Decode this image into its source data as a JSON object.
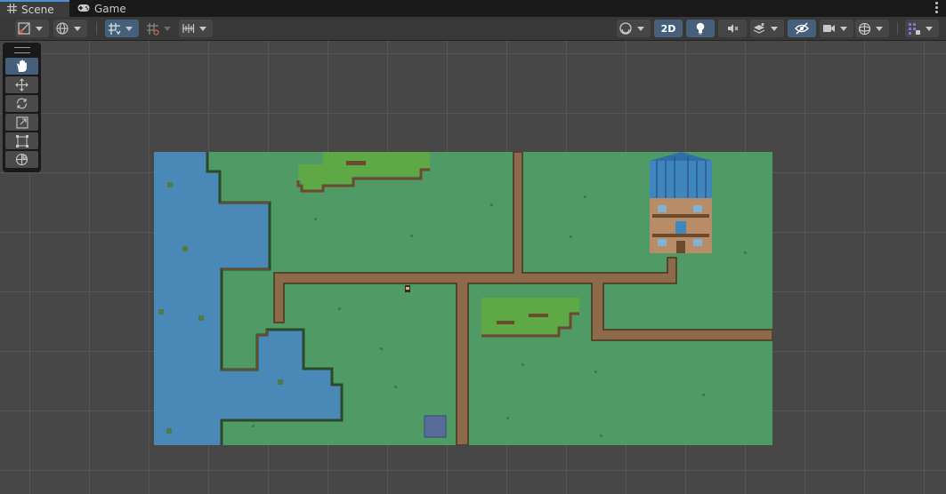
{
  "tabs": [
    {
      "label": "Scene",
      "icon": "grid-icon",
      "active": true
    },
    {
      "label": "Game",
      "icon": "gamepad-icon",
      "active": false
    }
  ],
  "toolbar": {
    "mode_2d_label": "2D"
  },
  "scene_tools": [
    "hand-tool",
    "move-tool",
    "rotate-tool",
    "scale-tool",
    "rect-tool",
    "transform-tool"
  ],
  "colors": {
    "water": "#4a88b8",
    "grass": "#4f9a65",
    "light_grass": "#5ea846",
    "path": "#8d6a4a",
    "cliff": "#6b4a2e",
    "roof": "#3f86bf",
    "accent_blue": "#46607c"
  }
}
